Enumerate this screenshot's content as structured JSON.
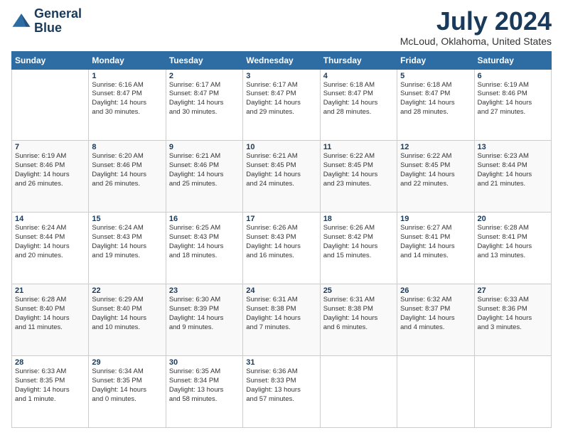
{
  "logo": {
    "line1": "General",
    "line2": "Blue"
  },
  "title": "July 2024",
  "subtitle": "McLoud, Oklahoma, United States",
  "days_header": [
    "Sunday",
    "Monday",
    "Tuesday",
    "Wednesday",
    "Thursday",
    "Friday",
    "Saturday"
  ],
  "weeks": [
    [
      {
        "day": "",
        "info": ""
      },
      {
        "day": "1",
        "info": "Sunrise: 6:16 AM\nSunset: 8:47 PM\nDaylight: 14 hours\nand 30 minutes."
      },
      {
        "day": "2",
        "info": "Sunrise: 6:17 AM\nSunset: 8:47 PM\nDaylight: 14 hours\nand 30 minutes."
      },
      {
        "day": "3",
        "info": "Sunrise: 6:17 AM\nSunset: 8:47 PM\nDaylight: 14 hours\nand 29 minutes."
      },
      {
        "day": "4",
        "info": "Sunrise: 6:18 AM\nSunset: 8:47 PM\nDaylight: 14 hours\nand 28 minutes."
      },
      {
        "day": "5",
        "info": "Sunrise: 6:18 AM\nSunset: 8:47 PM\nDaylight: 14 hours\nand 28 minutes."
      },
      {
        "day": "6",
        "info": "Sunrise: 6:19 AM\nSunset: 8:46 PM\nDaylight: 14 hours\nand 27 minutes."
      }
    ],
    [
      {
        "day": "7",
        "info": "Sunrise: 6:19 AM\nSunset: 8:46 PM\nDaylight: 14 hours\nand 26 minutes."
      },
      {
        "day": "8",
        "info": "Sunrise: 6:20 AM\nSunset: 8:46 PM\nDaylight: 14 hours\nand 26 minutes."
      },
      {
        "day": "9",
        "info": "Sunrise: 6:21 AM\nSunset: 8:46 PM\nDaylight: 14 hours\nand 25 minutes."
      },
      {
        "day": "10",
        "info": "Sunrise: 6:21 AM\nSunset: 8:45 PM\nDaylight: 14 hours\nand 24 minutes."
      },
      {
        "day": "11",
        "info": "Sunrise: 6:22 AM\nSunset: 8:45 PM\nDaylight: 14 hours\nand 23 minutes."
      },
      {
        "day": "12",
        "info": "Sunrise: 6:22 AM\nSunset: 8:45 PM\nDaylight: 14 hours\nand 22 minutes."
      },
      {
        "day": "13",
        "info": "Sunrise: 6:23 AM\nSunset: 8:44 PM\nDaylight: 14 hours\nand 21 minutes."
      }
    ],
    [
      {
        "day": "14",
        "info": "Sunrise: 6:24 AM\nSunset: 8:44 PM\nDaylight: 14 hours\nand 20 minutes."
      },
      {
        "day": "15",
        "info": "Sunrise: 6:24 AM\nSunset: 8:43 PM\nDaylight: 14 hours\nand 19 minutes."
      },
      {
        "day": "16",
        "info": "Sunrise: 6:25 AM\nSunset: 8:43 PM\nDaylight: 14 hours\nand 18 minutes."
      },
      {
        "day": "17",
        "info": "Sunrise: 6:26 AM\nSunset: 8:43 PM\nDaylight: 14 hours\nand 16 minutes."
      },
      {
        "day": "18",
        "info": "Sunrise: 6:26 AM\nSunset: 8:42 PM\nDaylight: 14 hours\nand 15 minutes."
      },
      {
        "day": "19",
        "info": "Sunrise: 6:27 AM\nSunset: 8:41 PM\nDaylight: 14 hours\nand 14 minutes."
      },
      {
        "day": "20",
        "info": "Sunrise: 6:28 AM\nSunset: 8:41 PM\nDaylight: 14 hours\nand 13 minutes."
      }
    ],
    [
      {
        "day": "21",
        "info": "Sunrise: 6:28 AM\nSunset: 8:40 PM\nDaylight: 14 hours\nand 11 minutes."
      },
      {
        "day": "22",
        "info": "Sunrise: 6:29 AM\nSunset: 8:40 PM\nDaylight: 14 hours\nand 10 minutes."
      },
      {
        "day": "23",
        "info": "Sunrise: 6:30 AM\nSunset: 8:39 PM\nDaylight: 14 hours\nand 9 minutes."
      },
      {
        "day": "24",
        "info": "Sunrise: 6:31 AM\nSunset: 8:38 PM\nDaylight: 14 hours\nand 7 minutes."
      },
      {
        "day": "25",
        "info": "Sunrise: 6:31 AM\nSunset: 8:38 PM\nDaylight: 14 hours\nand 6 minutes."
      },
      {
        "day": "26",
        "info": "Sunrise: 6:32 AM\nSunset: 8:37 PM\nDaylight: 14 hours\nand 4 minutes."
      },
      {
        "day": "27",
        "info": "Sunrise: 6:33 AM\nSunset: 8:36 PM\nDaylight: 14 hours\nand 3 minutes."
      }
    ],
    [
      {
        "day": "28",
        "info": "Sunrise: 6:33 AM\nSunset: 8:35 PM\nDaylight: 14 hours\nand 1 minute."
      },
      {
        "day": "29",
        "info": "Sunrise: 6:34 AM\nSunset: 8:35 PM\nDaylight: 14 hours\nand 0 minutes."
      },
      {
        "day": "30",
        "info": "Sunrise: 6:35 AM\nSunset: 8:34 PM\nDaylight: 13 hours\nand 58 minutes."
      },
      {
        "day": "31",
        "info": "Sunrise: 6:36 AM\nSunset: 8:33 PM\nDaylight: 13 hours\nand 57 minutes."
      },
      {
        "day": "",
        "info": ""
      },
      {
        "day": "",
        "info": ""
      },
      {
        "day": "",
        "info": ""
      }
    ]
  ]
}
